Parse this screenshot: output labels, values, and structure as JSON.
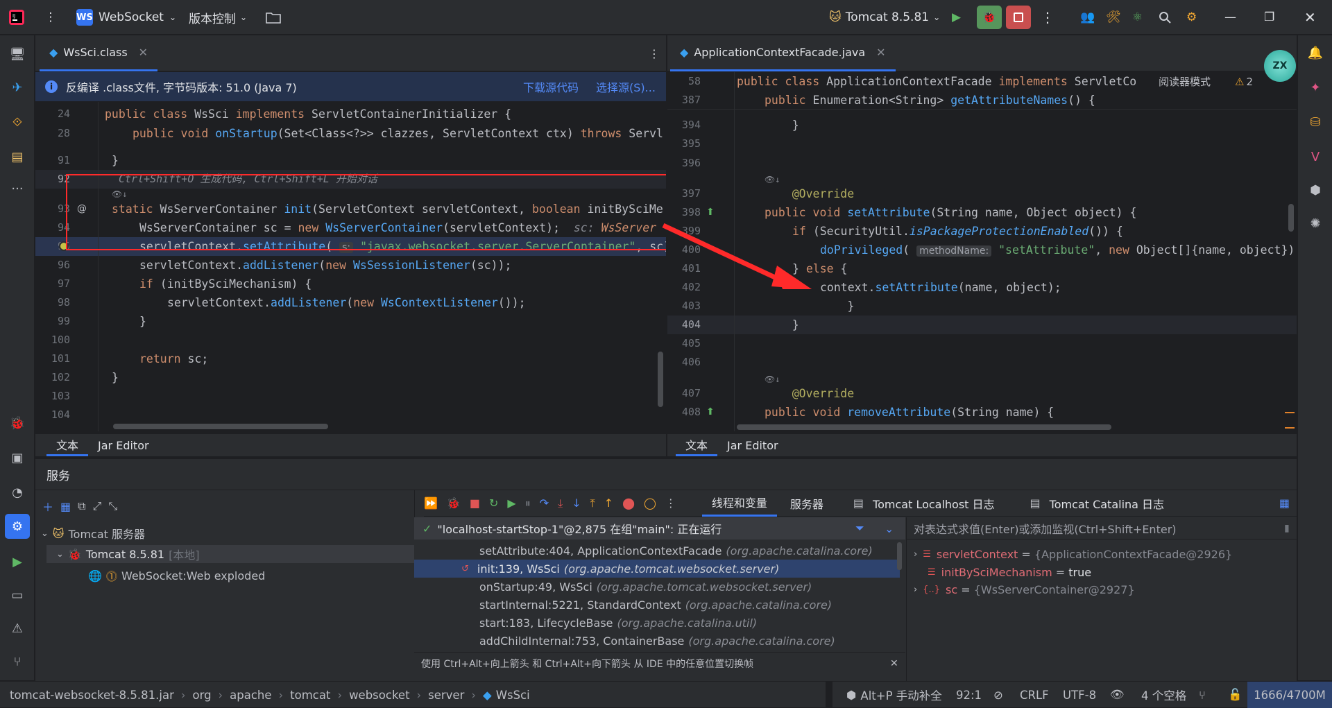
{
  "titlebar": {
    "project_badge": "WS",
    "project_name": "WebSocket",
    "vcs_label": "版本控制",
    "run_config": "Tomcat 8.5.81",
    "window_controls": [
      "minimize",
      "restore",
      "close"
    ]
  },
  "left_editor": {
    "tab_label": "WsSci.class",
    "banner_text": "反编译 .class文件, 字节码版本: 51.0 (Java 7)",
    "banner_link_download": "下载源代码",
    "banner_link_select": "选择源(S)...",
    "lines": [
      {
        "num": "24",
        "code": "public class WsSci implements ServletContainerInitializer {"
      },
      {
        "num": "28",
        "code": "    public void onStartup(Set<Class<?>> clazzes, ServletContext ctx) throws Servl"
      },
      {
        "num": "91",
        "code": "}"
      },
      {
        "num": "92",
        "hint": "Ctrl+Shift+O 生成代码, Ctrl+Shift+L 开始对话"
      },
      {
        "num": "93",
        "code": "static WsServerContainer init(ServletContext servletContext, boolean initBySciMe"
      },
      {
        "num": "94",
        "code": "    WsServerContainer sc = new WsServerContainer(servletContext);",
        "inlay": "sc: WsServer"
      },
      {
        "num": "95",
        "code_pre": "    servletContext.setAttribute(",
        "param_hint": "s:",
        "code_post": "\"javax.websocket.server.ServerContainer\", sc)"
      },
      {
        "num": "96",
        "code": "    servletContext.addListener(new WsSessionListener(sc));"
      },
      {
        "num": "97",
        "code": "    if (initBySciMechanism) {"
      },
      {
        "num": "98",
        "code": "        servletContext.addListener(new WsContextListener());"
      },
      {
        "num": "99",
        "code": "    }"
      },
      {
        "num": "100",
        "code": ""
      },
      {
        "num": "101",
        "code": "    return sc;"
      },
      {
        "num": "102",
        "code": "}"
      },
      {
        "num": "103",
        "code": ""
      },
      {
        "num": "104",
        "code": ""
      }
    ],
    "bottom_tabs": [
      "文本",
      "Jar Editor"
    ]
  },
  "right_editor": {
    "tab_label": "ApplicationContextFacade.java",
    "reader_mode": "阅读器模式",
    "warning_count": "2",
    "lines": [
      {
        "num": "58",
        "code": "public class ApplicationContextFacade implements ServletCo"
      },
      {
        "num": "387",
        "code": "    public Enumeration<String> getAttributeNames() {"
      },
      {
        "num": "394",
        "code": "    }"
      },
      {
        "num": "395",
        "code": ""
      },
      {
        "num": "396",
        "code": ""
      },
      {
        "num": "397",
        "code": "    @Override"
      },
      {
        "num": "398",
        "code": "    public void setAttribute(String name, Object object) {"
      },
      {
        "num": "399",
        "code": "        if (SecurityUtil.isPackageProtectionEnabled()) {"
      },
      {
        "num": "400",
        "code_pre": "            doPrivileged(",
        "param_hint": "methodName:",
        "code_post": "\"setAttribute\", new Object[]{name, object});"
      },
      {
        "num": "401",
        "code": "        } else {"
      },
      {
        "num": "402",
        "code": "            context.setAttribute(name, object);"
      },
      {
        "num": "403",
        "code": "        }"
      },
      {
        "num": "404",
        "code": "    }"
      },
      {
        "num": "405",
        "code": ""
      },
      {
        "num": "406",
        "code": ""
      },
      {
        "num": "407",
        "code": "    @Override"
      },
      {
        "num": "408",
        "code": "    public void removeAttribute(String name) {"
      }
    ],
    "bottom_tabs": [
      "文本",
      "Jar Editor"
    ]
  },
  "services": {
    "title": "服务",
    "tree": [
      {
        "label": "Tomcat 服务器",
        "extra": ""
      },
      {
        "label": "Tomcat 8.5.81",
        "extra": "[本地]"
      },
      {
        "label": "WebSocket:Web exploded",
        "extra": ""
      }
    ],
    "debug_tabs": [
      "线程和变量",
      "服务器",
      "Tomcat Localhost 日志",
      "Tomcat Catalina 日志"
    ],
    "thread_status": "\"localhost-startStop-1\"@2,875 在组\"main\": 正在运行",
    "frames": [
      {
        "method": "setAttribute:404, ApplicationContextFacade",
        "pkg": "(org.apache.catalina.core)"
      },
      {
        "method": "init:139, WsSci",
        "pkg": "(org.apache.tomcat.websocket.server)"
      },
      {
        "method": "onStartup:49, WsSci",
        "pkg": "(org.apache.tomcat.websocket.server)"
      },
      {
        "method": "startInternal:5221, StandardContext",
        "pkg": "(org.apache.catalina.core)"
      },
      {
        "method": "start:183, LifecycleBase",
        "pkg": "(org.apache.catalina.util)"
      },
      {
        "method": "addChildInternal:753, ContainerBase",
        "pkg": "(org.apache.catalina.core)"
      }
    ],
    "frames_tip": "使用 Ctrl+Alt+向上箭头 和 Ctrl+Alt+向下箭头 从 IDE 中的任意位置切换帧",
    "eval_placeholder": "对表达式求值(Enter)或添加监视(Ctrl+Shift+Enter)",
    "variables": [
      {
        "name": "servletContext",
        "eq": " = ",
        "value": "{ApplicationContextFacade@2926}"
      },
      {
        "name": "initBySciMechanism",
        "eq": " = ",
        "value": "true"
      },
      {
        "name": "sc",
        "eq": " = ",
        "value": "{WsServerContainer@2927}"
      }
    ]
  },
  "statusbar": {
    "breadcrumbs": [
      "tomcat-websocket-8.5.81.jar",
      "org",
      "apache",
      "tomcat",
      "websocket",
      "server",
      "WsSci"
    ],
    "completion": "Alt+P 手动补全",
    "position": "92:1",
    "line_sep": "CRLF",
    "encoding": "UTF-8",
    "indent": "4 个空格",
    "memory": "1666/4700M"
  },
  "colors": {
    "accent": "#3574f0",
    "red_annot": "#ff2a2a"
  }
}
